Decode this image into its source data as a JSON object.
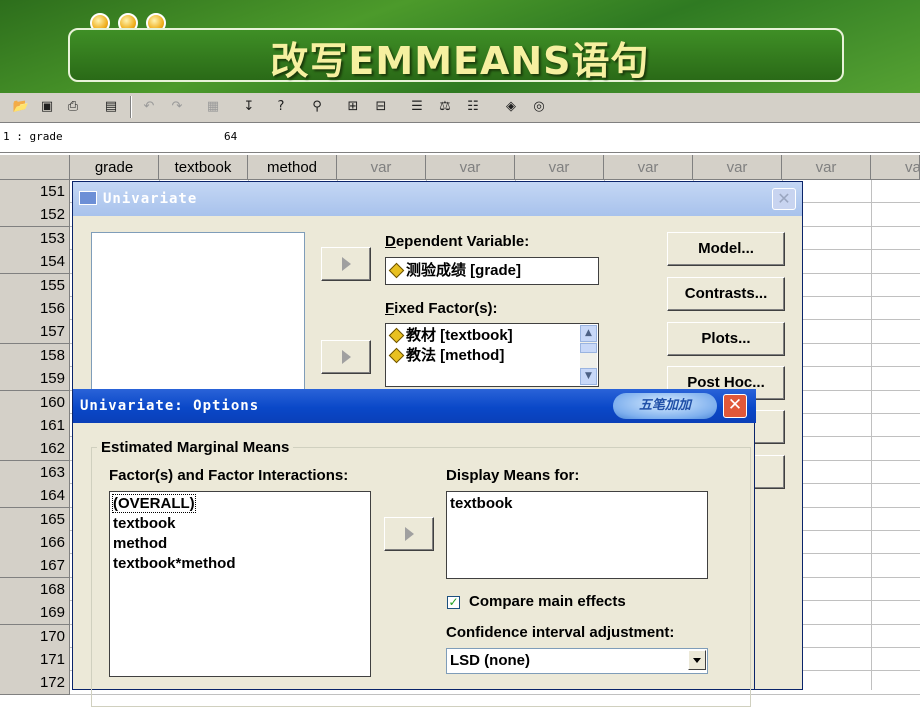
{
  "slide_title": "改写EMMEANS语句",
  "toolbar": {
    "icons": [
      "open-icon",
      "save-icon",
      "print-icon",
      "dialog-recall-icon",
      "undo-icon",
      "redo-icon",
      "goto-chart-icon",
      "goto-case-icon",
      "variables-icon",
      "find-icon",
      "insert-case-icon",
      "insert-variable-icon",
      "split-file-icon",
      "weight-cases-icon",
      "select-cases-icon",
      "value-labels-icon",
      "use-sets-icon"
    ]
  },
  "cell_editor": {
    "reference": "1 : grade",
    "value": "64"
  },
  "grid": {
    "columns": [
      "grade",
      "textbook",
      "method",
      "var",
      "var",
      "var",
      "var",
      "var",
      "var",
      "va"
    ],
    "rows": [
      "151",
      "152",
      "153",
      "154",
      "155",
      "156",
      "157",
      "158",
      "159",
      "160",
      "161",
      "162",
      "163",
      "164",
      "165",
      "166",
      "167",
      "168",
      "169",
      "170",
      "171",
      "172"
    ]
  },
  "univariate": {
    "title": "Univariate",
    "dependent_label": "Dependent Variable:",
    "dependent_value": "测验成绩 [grade]",
    "fixed_label": "Fixed Factor(s):",
    "fixed_items": [
      "教材 [textbook]",
      "教法 [method]"
    ],
    "buttons": {
      "model": "Model...",
      "contrasts": "Contrasts...",
      "plots": "Plots...",
      "posthoc": "Post Hoc..."
    },
    "hidden_button_tail": "..."
  },
  "options": {
    "title": "Univariate: Options",
    "brand_badge": "五笔加加",
    "group_label": "Estimated Marginal Means",
    "factors_label": "Factor(s) and Factor Interactions:",
    "factors": [
      "(OVERALL)",
      "textbook",
      "method",
      "textbook*method"
    ],
    "display_label": "Display Means for:",
    "display_items": [
      "textbook"
    ],
    "compare_label": "Compare main effects",
    "compare_checked": true,
    "ci_label": "Confidence interval adjustment:",
    "ci_value": "LSD (none)"
  }
}
